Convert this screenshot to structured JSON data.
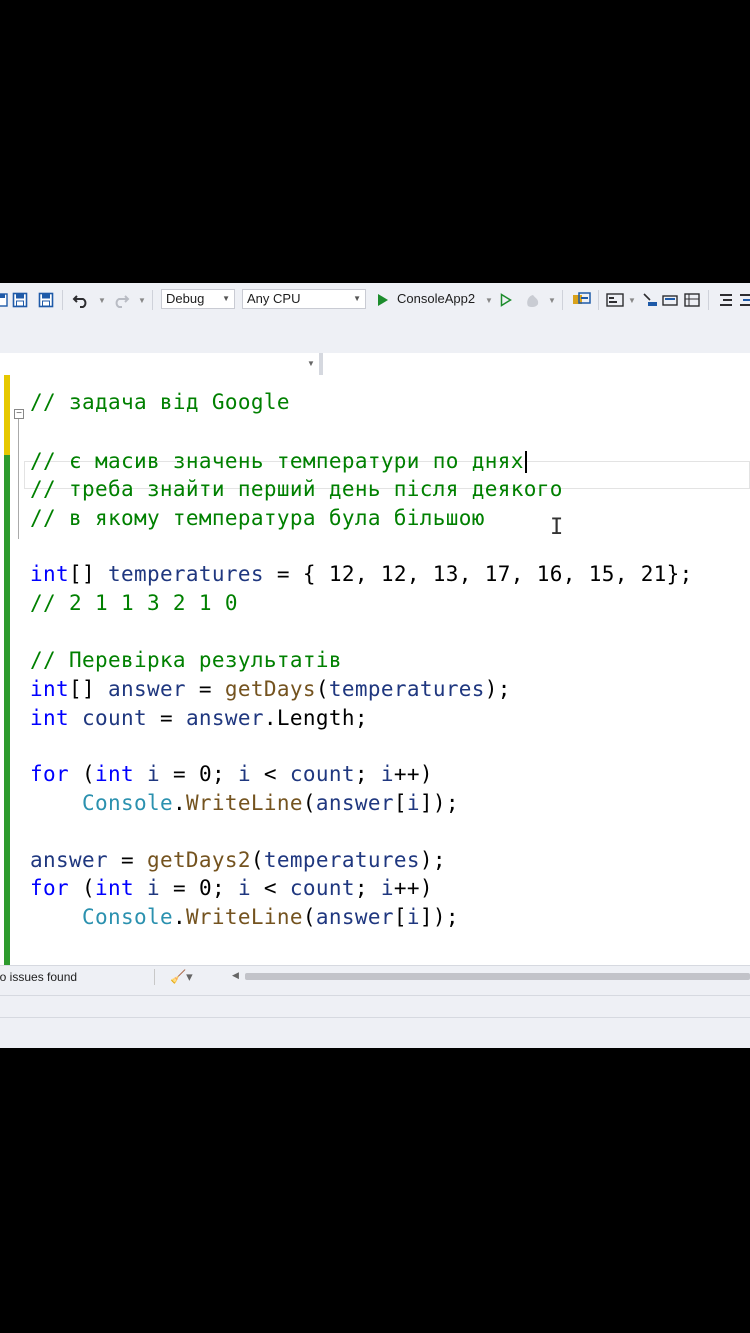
{
  "toolbar": {
    "icons": [
      "save-icon",
      "save-all-icon",
      "undo-icon",
      "redo-icon",
      "start-icon",
      "start-without-debugging-icon",
      "hot-reload-icon",
      "toolbox-icon",
      "layout-icon",
      "step-icon",
      "breakpoint-icon",
      "comment-icon"
    ],
    "configuration": "Debug",
    "platform": "Any CPU",
    "run_target": "ConsoleApp2"
  },
  "editor": {
    "lines": [
      {
        "id": "l1",
        "tokens": [
          {
            "c": "cm",
            "t": "// задача від Google"
          }
        ]
      },
      {
        "id": "l2",
        "tokens": [
          {
            "c": "cm",
            "t": "// є масив значень температури по днях"
          }
        ]
      },
      {
        "id": "l3",
        "tokens": [
          {
            "c": "cm",
            "t": "// треба знайти перший день після деякого"
          }
        ]
      },
      {
        "id": "l4",
        "tokens": [
          {
            "c": "cm",
            "t": "// в якому температура була більшою"
          }
        ]
      },
      {
        "id": "l5",
        "tokens": [
          {
            "c": "kw",
            "t": "int"
          },
          {
            "c": "nm",
            "t": "[] "
          },
          {
            "c": "id",
            "t": "temperatures"
          },
          {
            "c": "nm",
            "t": " = { 12, 12, 13, 17, 16, 15, 21};"
          }
        ]
      },
      {
        "id": "l6",
        "tokens": [
          {
            "c": "cm",
            "t": "// 2 1 1 3 2 1 0"
          }
        ]
      },
      {
        "id": "l7",
        "tokens": [
          {
            "c": "cm",
            "t": "// Перевірка результатів"
          }
        ]
      },
      {
        "id": "l8",
        "tokens": [
          {
            "c": "kw",
            "t": "int"
          },
          {
            "c": "nm",
            "t": "[] "
          },
          {
            "c": "id",
            "t": "answer"
          },
          {
            "c": "nm",
            "t": " = "
          },
          {
            "c": "fn",
            "t": "getDays"
          },
          {
            "c": "nm",
            "t": "("
          },
          {
            "c": "id",
            "t": "temperatures"
          },
          {
            "c": "nm",
            "t": ");"
          }
        ]
      },
      {
        "id": "l9",
        "tokens": [
          {
            "c": "kw",
            "t": "int"
          },
          {
            "c": "nm",
            "t": " "
          },
          {
            "c": "id",
            "t": "count"
          },
          {
            "c": "nm",
            "t": " = "
          },
          {
            "c": "id",
            "t": "answer"
          },
          {
            "c": "nm",
            "t": "."
          },
          {
            "c": "nm",
            "t": "Length"
          },
          {
            "c": "nm",
            "t": ";"
          }
        ]
      },
      {
        "id": "l10",
        "tokens": [
          {
            "c": "kw",
            "t": "for"
          },
          {
            "c": "nm",
            "t": " ("
          },
          {
            "c": "kw",
            "t": "int"
          },
          {
            "c": "nm",
            "t": " "
          },
          {
            "c": "id",
            "t": "i"
          },
          {
            "c": "nm",
            "t": " = 0; "
          },
          {
            "c": "id",
            "t": "i"
          },
          {
            "c": "nm",
            "t": " < "
          },
          {
            "c": "id",
            "t": "count"
          },
          {
            "c": "nm",
            "t": "; "
          },
          {
            "c": "id",
            "t": "i"
          },
          {
            "c": "nm",
            "t": "++)"
          }
        ]
      },
      {
        "id": "l11",
        "tokens": [
          {
            "c": "nm",
            "t": "    "
          },
          {
            "c": "ty",
            "t": "Console"
          },
          {
            "c": "nm",
            "t": "."
          },
          {
            "c": "fn",
            "t": "WriteLine"
          },
          {
            "c": "nm",
            "t": "("
          },
          {
            "c": "id",
            "t": "answer"
          },
          {
            "c": "nm",
            "t": "["
          },
          {
            "c": "id",
            "t": "i"
          },
          {
            "c": "nm",
            "t": "]);"
          }
        ]
      },
      {
        "id": "l12",
        "tokens": [
          {
            "c": "id",
            "t": "answer"
          },
          {
            "c": "nm",
            "t": " = "
          },
          {
            "c": "fn",
            "t": "getDays2"
          },
          {
            "c": "nm",
            "t": "("
          },
          {
            "c": "id",
            "t": "temperatures"
          },
          {
            "c": "nm",
            "t": ");"
          }
        ]
      },
      {
        "id": "l13",
        "tokens": [
          {
            "c": "kw",
            "t": "for"
          },
          {
            "c": "nm",
            "t": " ("
          },
          {
            "c": "kw",
            "t": "int"
          },
          {
            "c": "nm",
            "t": " "
          },
          {
            "c": "id",
            "t": "i"
          },
          {
            "c": "nm",
            "t": " = 0; "
          },
          {
            "c": "id",
            "t": "i"
          },
          {
            "c": "nm",
            "t": " < "
          },
          {
            "c": "id",
            "t": "count"
          },
          {
            "c": "nm",
            "t": "; "
          },
          {
            "c": "id",
            "t": "i"
          },
          {
            "c": "nm",
            "t": "++)"
          }
        ]
      },
      {
        "id": "l14",
        "tokens": [
          {
            "c": "nm",
            "t": "    "
          },
          {
            "c": "ty",
            "t": "Console"
          },
          {
            "c": "nm",
            "t": "."
          },
          {
            "c": "fn",
            "t": "WriteLine"
          },
          {
            "c": "nm",
            "t": "("
          },
          {
            "c": "id",
            "t": "answer"
          },
          {
            "c": "nm",
            "t": "["
          },
          {
            "c": "id",
            "t": "i"
          },
          {
            "c": "nm",
            "t": "]);"
          }
        ]
      }
    ]
  },
  "status": {
    "issues": "lo issues found"
  }
}
